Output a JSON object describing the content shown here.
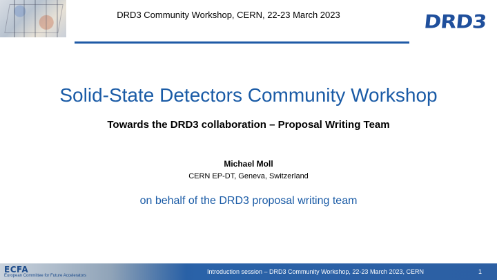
{
  "header": {
    "title": "DRD3 Community Workshop, CERN, 22-23 March 2023",
    "logo_text": "DRD3"
  },
  "main": {
    "title": "Solid-State Detectors Community Workshop",
    "subtitle": "Towards the DRD3 collaboration – Proposal Writing Team",
    "author": "Michael Moll",
    "affiliation": "CERN EP-DT, Geneva, Switzerland",
    "behalf": "on behalf of the DRD3 proposal writing team"
  },
  "footer": {
    "ecfa_logo": "ECFA",
    "ecfa_subtitle": "European Committee for Future Accelerators",
    "text": "Introduction session  – DRD3 Community Workshop, 22-23 March 2023, CERN",
    "page_number": "1"
  },
  "colors": {
    "accent_blue": "#1a5ba6",
    "footer_blue": "#2c5fa3"
  }
}
